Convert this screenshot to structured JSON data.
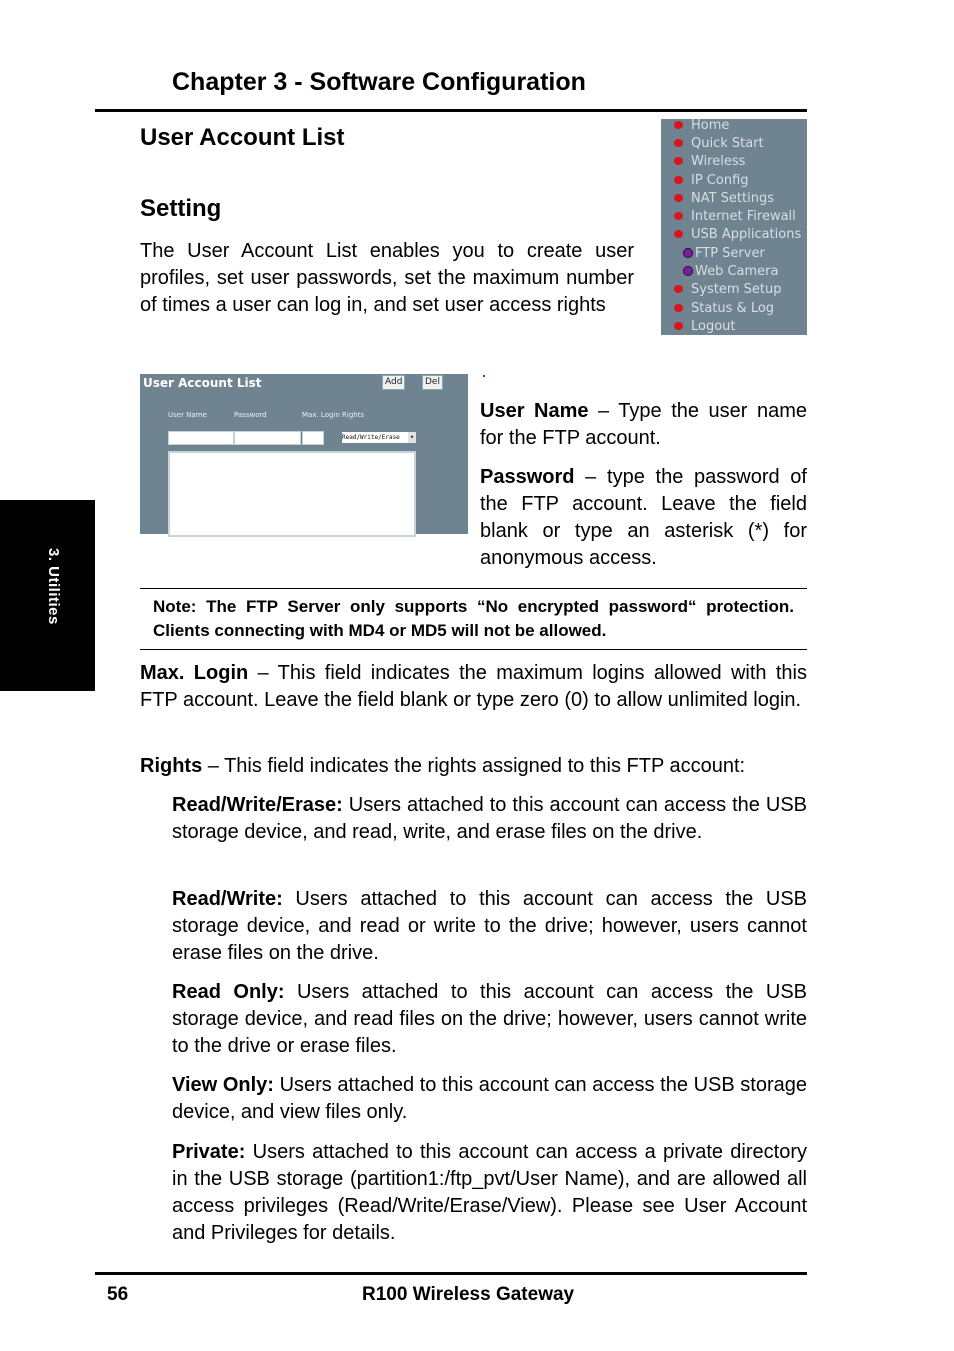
{
  "header": {
    "chapter_title": "Chapter 3 - Software Configuration"
  },
  "side_tab": {
    "label": "3. Utilities"
  },
  "section": {
    "title": "User Account List",
    "subtitle": "Setting",
    "intro": "The User Account List enables you to create user profiles, set user passwords, set the maximum number of times a user can log in, and set user access rights"
  },
  "nav_menu": {
    "items": [
      {
        "label": "Home",
        "level": 1
      },
      {
        "label": "Quick Start",
        "level": 1
      },
      {
        "label": "Wireless",
        "level": 1
      },
      {
        "label": "IP Config",
        "level": 1
      },
      {
        "label": "NAT Settings",
        "level": 1
      },
      {
        "label": "Internet Firewall",
        "level": 1
      },
      {
        "label": "USB Applications",
        "level": 1
      },
      {
        "label": "FTP Server",
        "level": 2
      },
      {
        "label": "Web Camera",
        "level": 2
      },
      {
        "label": "System Setup",
        "level": 1
      },
      {
        "label": "Status & Log",
        "level": 1
      },
      {
        "label": "Logout",
        "level": 1
      }
    ],
    "colors": {
      "background": "#6f8391",
      "bullet_main": "#d8141c",
      "bullet_sub": "#7b1fa0"
    }
  },
  "screenshot": {
    "title": "User Account List",
    "add_button": "Add",
    "del_button": "Del",
    "columns": [
      "User Name",
      "Password",
      "Max. Login Rights"
    ],
    "user_name_value": "",
    "password_value": "",
    "max_login_value": "",
    "rights_selected": "Read/Write/Erase",
    "account_list_items": []
  },
  "fields": {
    "user_name": {
      "term": "User Name",
      "desc": " – Type the user name for the FTP account."
    },
    "password": {
      "term": "Password",
      "desc": " – type the password of the FTP account. Leave the field blank  or type an asterisk (*) for anonymous access."
    }
  },
  "note": "Note: The FTP Server only supports “No encrypted password“ protection. Clients connecting with MD4 or MD5 will not be allowed.",
  "max_login": {
    "term": "Max. Login",
    "desc": " – This field indicates the maximum logins allowed with this FTP account. Leave the field blank or type zero (0) to allow unlimited login."
  },
  "rights": {
    "term": "Rights",
    "desc": " – This field indicates the rights assigned to this FTP account:",
    "items": [
      {
        "term": "Read/Write/Erase:",
        "desc": " Users attached to this account can access the USB storage device, and read, write, and erase files on the drive."
      },
      {
        "term": "Read/Write:",
        "desc": " Users attached to this account can access the USB storage device, and read or write to the drive; however, users cannot erase files on the drive."
      },
      {
        "term": "Read Only:",
        "desc": " Users attached to this account can access the USB storage device, and read files on the drive; however, users cannot write to the drive or erase files."
      },
      {
        "term": "View Only:",
        "desc": " Users attached to this account can access the USB storage device, and view files only."
      },
      {
        "term": "Private:",
        "desc": " Users attached to this account can access a private directory in the USB storage (partition1:/ftp_pvt/User Name), and are allowed all access privileges (Read/Write/Erase/View). Please see User Account and Privileges for details."
      }
    ]
  },
  "footer": {
    "page_number": "56",
    "product": "R100 Wireless Gateway"
  }
}
